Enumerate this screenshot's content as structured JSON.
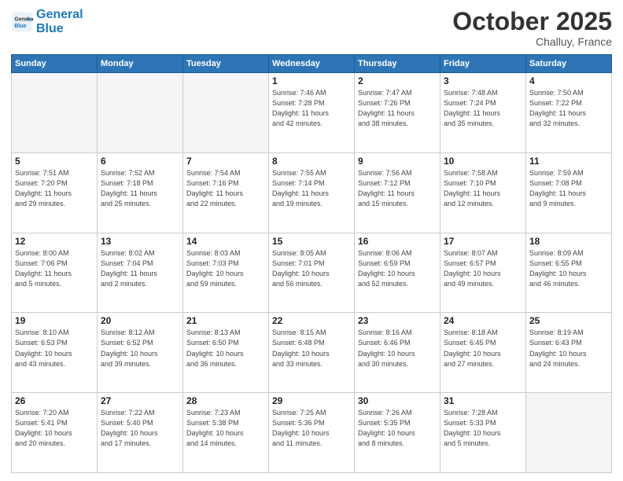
{
  "header": {
    "logo_line1": "General",
    "logo_line2": "Blue",
    "month": "October 2025",
    "location": "Challuy, France"
  },
  "weekdays": [
    "Sunday",
    "Monday",
    "Tuesday",
    "Wednesday",
    "Thursday",
    "Friday",
    "Saturday"
  ],
  "weeks": [
    [
      {
        "day": "",
        "info": ""
      },
      {
        "day": "",
        "info": ""
      },
      {
        "day": "",
        "info": ""
      },
      {
        "day": "1",
        "info": "Sunrise: 7:46 AM\nSunset: 7:28 PM\nDaylight: 11 hours\nand 42 minutes."
      },
      {
        "day": "2",
        "info": "Sunrise: 7:47 AM\nSunset: 7:26 PM\nDaylight: 11 hours\nand 38 minutes."
      },
      {
        "day": "3",
        "info": "Sunrise: 7:48 AM\nSunset: 7:24 PM\nDaylight: 11 hours\nand 35 minutes."
      },
      {
        "day": "4",
        "info": "Sunrise: 7:50 AM\nSunset: 7:22 PM\nDaylight: 11 hours\nand 32 minutes."
      }
    ],
    [
      {
        "day": "5",
        "info": "Sunrise: 7:51 AM\nSunset: 7:20 PM\nDaylight: 11 hours\nand 29 minutes."
      },
      {
        "day": "6",
        "info": "Sunrise: 7:52 AM\nSunset: 7:18 PM\nDaylight: 11 hours\nand 25 minutes."
      },
      {
        "day": "7",
        "info": "Sunrise: 7:54 AM\nSunset: 7:16 PM\nDaylight: 11 hours\nand 22 minutes."
      },
      {
        "day": "8",
        "info": "Sunrise: 7:55 AM\nSunset: 7:14 PM\nDaylight: 11 hours\nand 19 minutes."
      },
      {
        "day": "9",
        "info": "Sunrise: 7:56 AM\nSunset: 7:12 PM\nDaylight: 11 hours\nand 15 minutes."
      },
      {
        "day": "10",
        "info": "Sunrise: 7:58 AM\nSunset: 7:10 PM\nDaylight: 11 hours\nand 12 minutes."
      },
      {
        "day": "11",
        "info": "Sunrise: 7:59 AM\nSunset: 7:08 PM\nDaylight: 11 hours\nand 9 minutes."
      }
    ],
    [
      {
        "day": "12",
        "info": "Sunrise: 8:00 AM\nSunset: 7:06 PM\nDaylight: 11 hours\nand 5 minutes."
      },
      {
        "day": "13",
        "info": "Sunrise: 8:02 AM\nSunset: 7:04 PM\nDaylight: 11 hours\nand 2 minutes."
      },
      {
        "day": "14",
        "info": "Sunrise: 8:03 AM\nSunset: 7:03 PM\nDaylight: 10 hours\nand 59 minutes."
      },
      {
        "day": "15",
        "info": "Sunrise: 8:05 AM\nSunset: 7:01 PM\nDaylight: 10 hours\nand 56 minutes."
      },
      {
        "day": "16",
        "info": "Sunrise: 8:06 AM\nSunset: 6:59 PM\nDaylight: 10 hours\nand 52 minutes."
      },
      {
        "day": "17",
        "info": "Sunrise: 8:07 AM\nSunset: 6:57 PM\nDaylight: 10 hours\nand 49 minutes."
      },
      {
        "day": "18",
        "info": "Sunrise: 8:09 AM\nSunset: 6:55 PM\nDaylight: 10 hours\nand 46 minutes."
      }
    ],
    [
      {
        "day": "19",
        "info": "Sunrise: 8:10 AM\nSunset: 6:53 PM\nDaylight: 10 hours\nand 43 minutes."
      },
      {
        "day": "20",
        "info": "Sunrise: 8:12 AM\nSunset: 6:52 PM\nDaylight: 10 hours\nand 39 minutes."
      },
      {
        "day": "21",
        "info": "Sunrise: 8:13 AM\nSunset: 6:50 PM\nDaylight: 10 hours\nand 36 minutes."
      },
      {
        "day": "22",
        "info": "Sunrise: 8:15 AM\nSunset: 6:48 PM\nDaylight: 10 hours\nand 33 minutes."
      },
      {
        "day": "23",
        "info": "Sunrise: 8:16 AM\nSunset: 6:46 PM\nDaylight: 10 hours\nand 30 minutes."
      },
      {
        "day": "24",
        "info": "Sunrise: 8:18 AM\nSunset: 6:45 PM\nDaylight: 10 hours\nand 27 minutes."
      },
      {
        "day": "25",
        "info": "Sunrise: 8:19 AM\nSunset: 6:43 PM\nDaylight: 10 hours\nand 24 minutes."
      }
    ],
    [
      {
        "day": "26",
        "info": "Sunrise: 7:20 AM\nSunset: 5:41 PM\nDaylight: 10 hours\nand 20 minutes."
      },
      {
        "day": "27",
        "info": "Sunrise: 7:22 AM\nSunset: 5:40 PM\nDaylight: 10 hours\nand 17 minutes."
      },
      {
        "day": "28",
        "info": "Sunrise: 7:23 AM\nSunset: 5:38 PM\nDaylight: 10 hours\nand 14 minutes."
      },
      {
        "day": "29",
        "info": "Sunrise: 7:25 AM\nSunset: 5:36 PM\nDaylight: 10 hours\nand 11 minutes."
      },
      {
        "day": "30",
        "info": "Sunrise: 7:26 AM\nSunset: 5:35 PM\nDaylight: 10 hours\nand 8 minutes."
      },
      {
        "day": "31",
        "info": "Sunrise: 7:28 AM\nSunset: 5:33 PM\nDaylight: 10 hours\nand 5 minutes."
      },
      {
        "day": "",
        "info": ""
      }
    ]
  ]
}
